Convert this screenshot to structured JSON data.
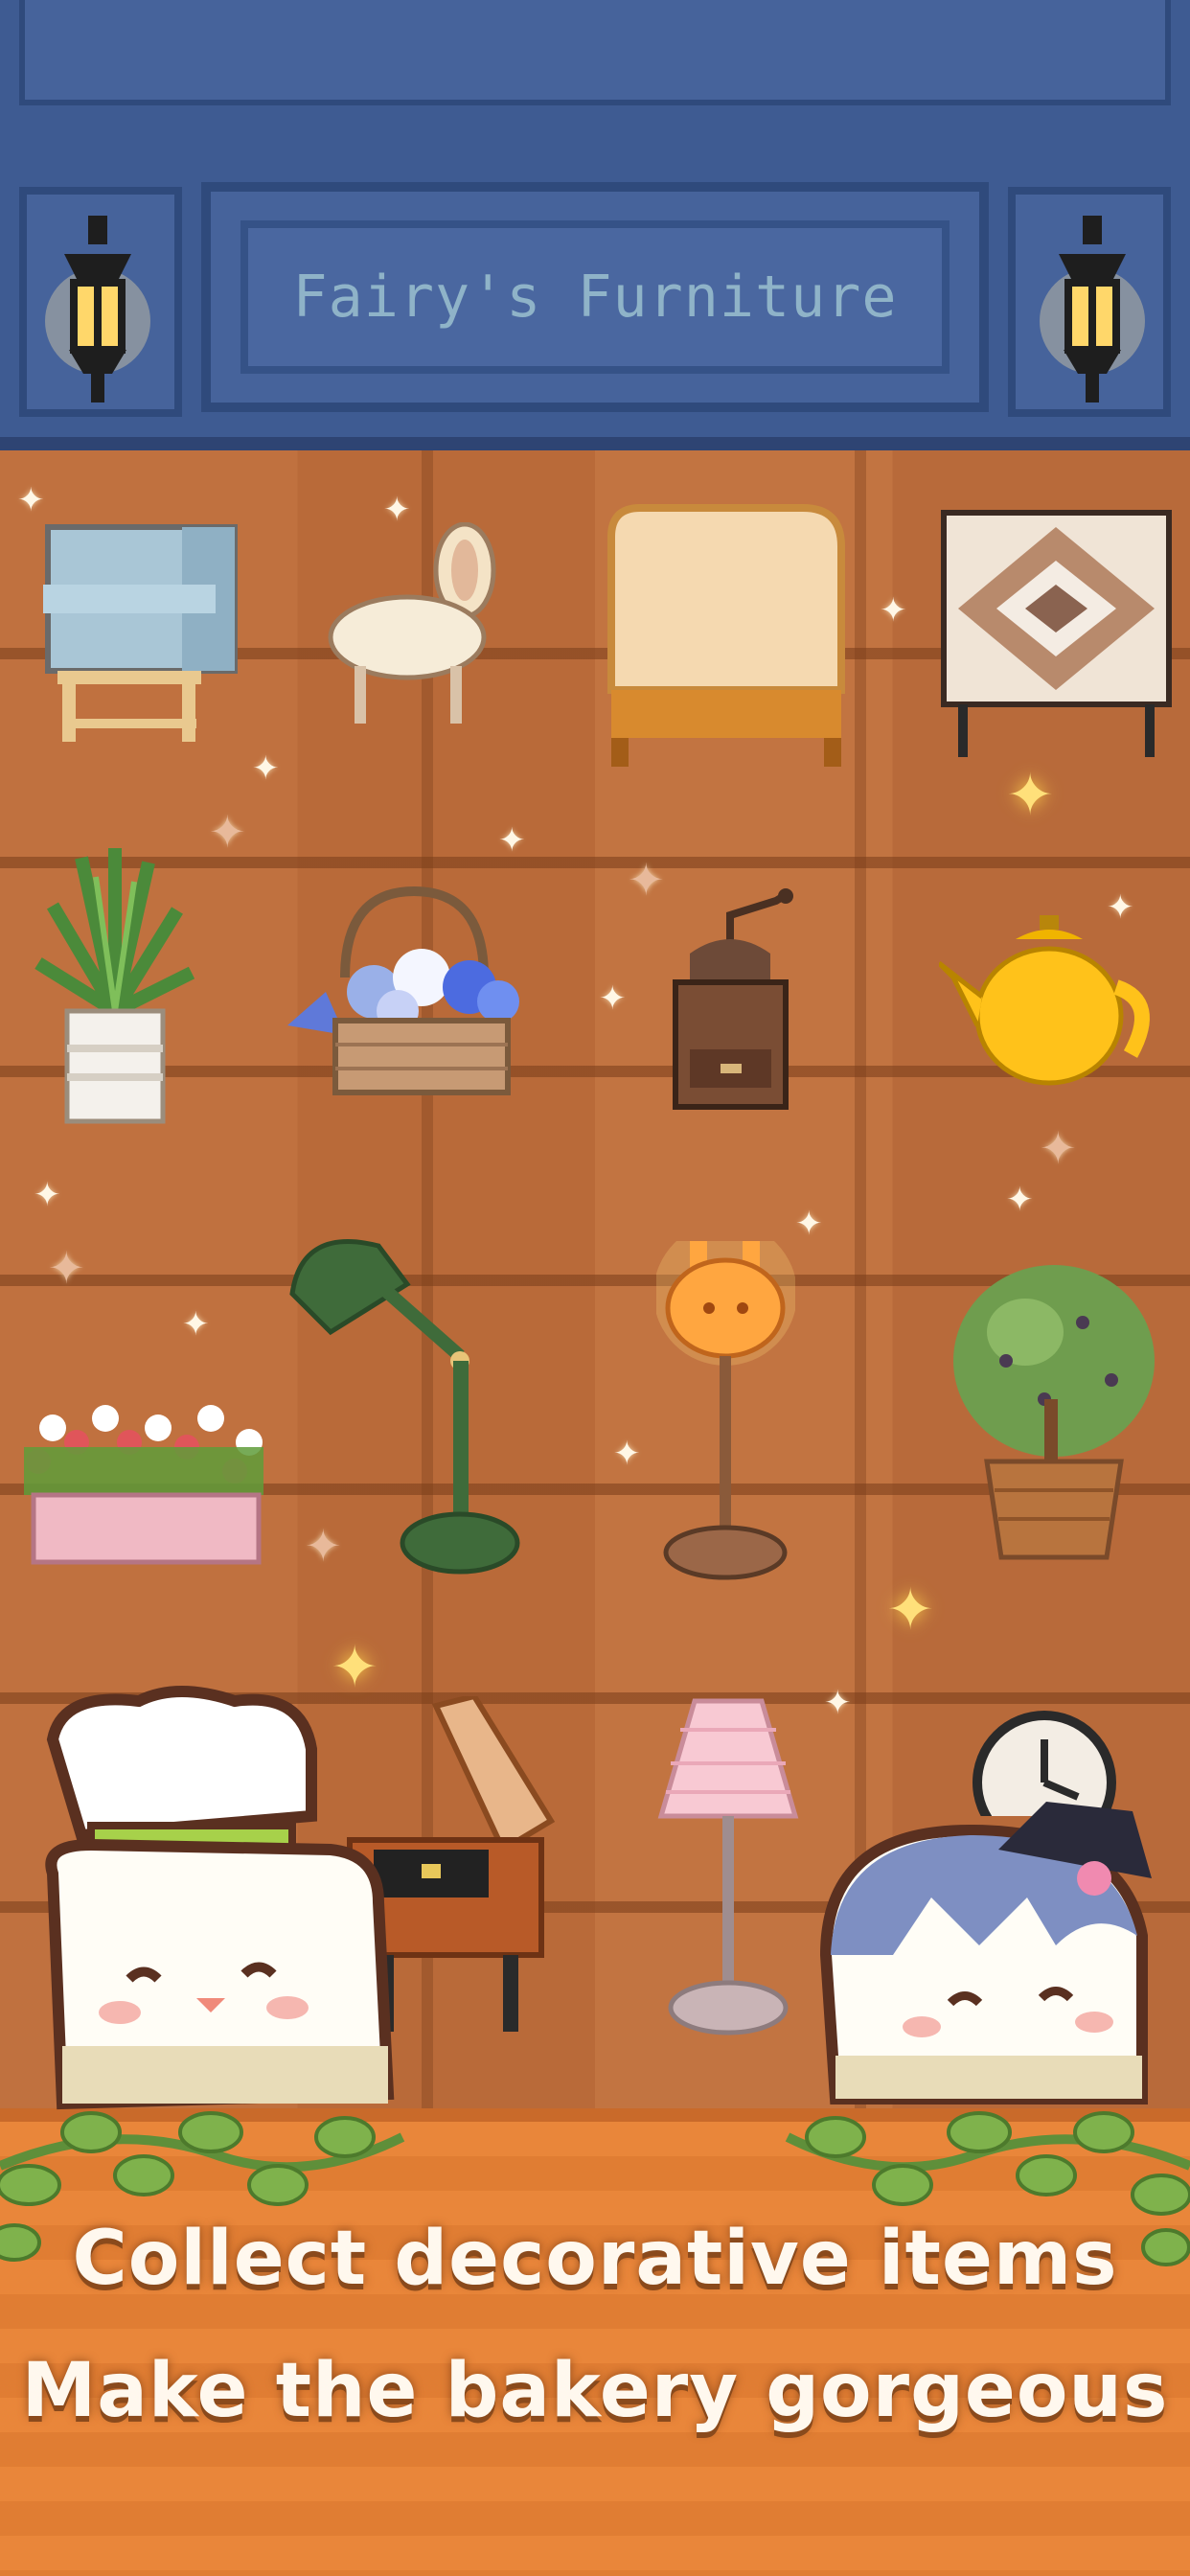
{
  "shop": {
    "title": "Fairy's Furniture"
  },
  "caption": {
    "line1": "Collect decorative items",
    "line2": "Make the bakery gorgeous"
  },
  "items": [
    {
      "name": "armchair-blue",
      "icon": "armchair-icon"
    },
    {
      "name": "bunny-chair",
      "icon": "chair-icon"
    },
    {
      "name": "toast-bed",
      "icon": "bed-icon"
    },
    {
      "name": "patterned-screen",
      "icon": "screen-icon"
    },
    {
      "name": "potted-snake-plant",
      "icon": "plant-icon"
    },
    {
      "name": "flower-basket",
      "icon": "basket-icon"
    },
    {
      "name": "coffee-grinder",
      "icon": "grinder-icon"
    },
    {
      "name": "yellow-teapot",
      "icon": "teapot-icon"
    },
    {
      "name": "flower-box",
      "icon": "flowerbox-icon"
    },
    {
      "name": "green-desk-lamp",
      "icon": "lamp-icon"
    },
    {
      "name": "bunny-floor-lamp",
      "icon": "floor-lamp-icon"
    },
    {
      "name": "olive-tree",
      "icon": "tree-icon"
    },
    {
      "name": "gramophone-piano",
      "icon": "piano-icon"
    },
    {
      "name": "pink-floor-lamp",
      "icon": "floor-lamp-icon"
    },
    {
      "name": "wall-clock",
      "icon": "clock-icon"
    }
  ],
  "colors": {
    "sign_blue": "#3e5b92",
    "wall_wood": "#c0713f",
    "floor_orange": "#e9863a",
    "caption_text": "#fff8ee"
  }
}
